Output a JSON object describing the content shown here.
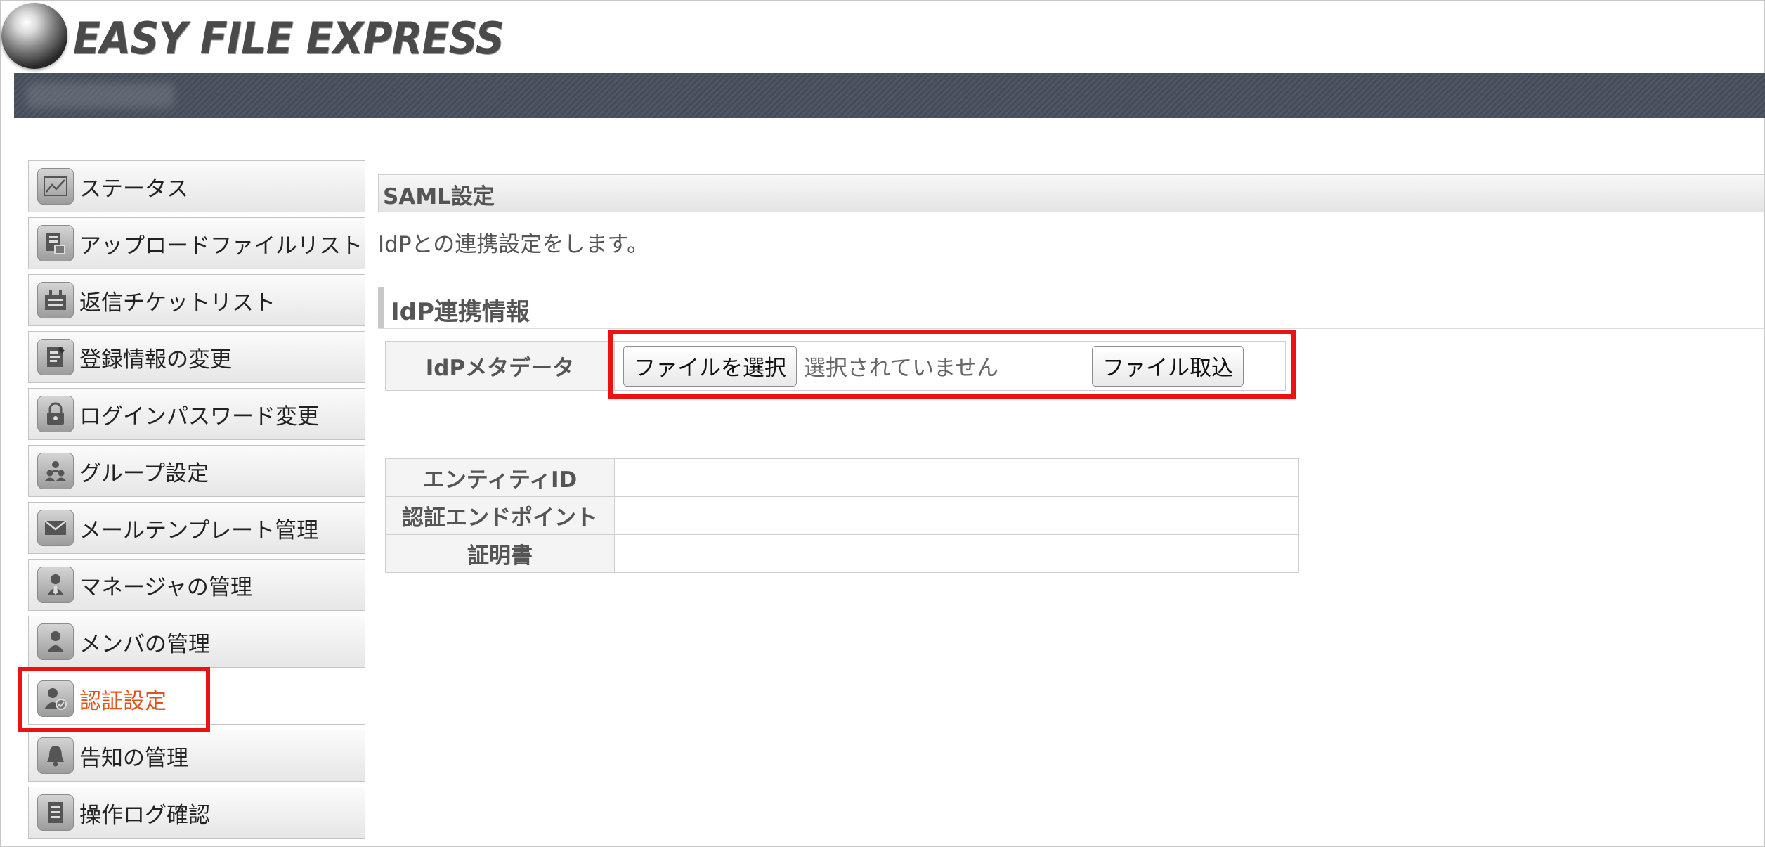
{
  "header": {
    "logo_text": "EASY FILE EXPRESS"
  },
  "sidebar": {
    "items": [
      {
        "label": "ステータス",
        "icon": "chart-icon"
      },
      {
        "label": "アップロードファイルリスト",
        "icon": "file-list-icon"
      },
      {
        "label": "返信チケットリスト",
        "icon": "ticket-icon"
      },
      {
        "label": "登録情報の変更",
        "icon": "edit-document-icon"
      },
      {
        "label": "ログインパスワード変更",
        "icon": "lock-icon"
      },
      {
        "label": "グループ設定",
        "icon": "group-icon"
      },
      {
        "label": "メールテンプレート管理",
        "icon": "mail-icon"
      },
      {
        "label": "マネージャの管理",
        "icon": "manager-icon"
      },
      {
        "label": "メンバの管理",
        "icon": "member-icon"
      },
      {
        "label": "認証設定",
        "icon": "auth-user-icon",
        "active": true
      },
      {
        "label": "告知の管理",
        "icon": "bell-icon"
      },
      {
        "label": "操作ログ確認",
        "icon": "log-icon"
      }
    ]
  },
  "main": {
    "section_title": "SAML設定",
    "description": "IdPとの連携設定をします。",
    "subheading": "IdP連携情報",
    "metadata": {
      "label": "IdPメタデータ",
      "choose_file_button": "ファイルを選択",
      "file_status": "選択されていません",
      "import_button": "ファイル取込"
    },
    "info_rows": [
      {
        "label": "エンティティID",
        "value": ""
      },
      {
        "label": "認証エンドポイント",
        "value": ""
      },
      {
        "label": "証明書",
        "value": ""
      }
    ]
  },
  "colors": {
    "active_label": "#e0541c",
    "highlight": "#ee1111",
    "topbar": "#4e5763"
  }
}
